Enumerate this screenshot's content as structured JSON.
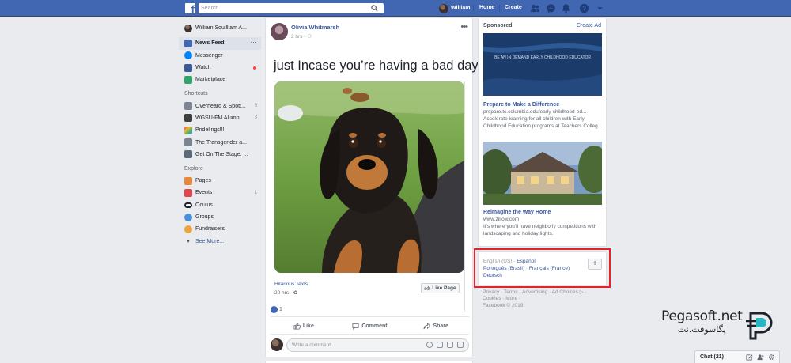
{
  "colors": {
    "brand": "#4267b2",
    "link": "#365899",
    "highlight": "#e4222a"
  },
  "topbar": {
    "search_placeholder": "Search",
    "user_name": "William",
    "home": "Home",
    "create": "Create",
    "icons": [
      "friends-icon",
      "messenger-icon",
      "notifications-icon",
      "help-icon",
      "chevron-down-icon"
    ]
  },
  "left_nav": {
    "profile": "William Squilliam A...",
    "main": [
      {
        "label": "News Feed",
        "icon": "news-feed-icon",
        "color": "#4267b2",
        "active": true
      },
      {
        "label": "Messenger",
        "icon": "messenger-icon",
        "color": "#0084ff"
      },
      {
        "label": "Watch",
        "icon": "watch-icon",
        "color": "#3b5998",
        "dot": true
      },
      {
        "label": "Marketplace",
        "icon": "marketplace-icon",
        "color": "#30a46c"
      }
    ],
    "shortcuts_title": "Shortcuts",
    "shortcuts": [
      {
        "label": "Overheard & Spott...",
        "count": "6",
        "icon": "megaphone-icon",
        "color": "#7a8591"
      },
      {
        "label": "WGSU-FM Alumni",
        "count": "3",
        "icon": "group-icon",
        "color": "#3d3d3d"
      },
      {
        "label": "Pridelings!!!",
        "count": "",
        "icon": "rainbow-icon",
        "color": "#e8883a"
      },
      {
        "label": "The Transgender a...",
        "count": "",
        "icon": "group-icon",
        "color": "#7a8591"
      },
      {
        "label": "Get On The Stage: ...",
        "count": "",
        "icon": "group-icon",
        "color": "#5b6978"
      }
    ],
    "explore_title": "Explore",
    "explore": [
      {
        "label": "Pages",
        "count": "",
        "icon": "pages-icon",
        "color": "#e8883a"
      },
      {
        "label": "Events",
        "count": "1",
        "icon": "events-icon",
        "color": "#e0474c"
      },
      {
        "label": "Oculus",
        "count": "",
        "icon": "oculus-icon",
        "color": "#1d2129"
      },
      {
        "label": "Groups",
        "count": "",
        "icon": "groups-icon",
        "color": "#4a90d9"
      },
      {
        "label": "Fundraisers",
        "count": "",
        "icon": "fundraisers-icon",
        "color": "#f0a33c"
      }
    ],
    "see_more": "See More..."
  },
  "post": {
    "author": "Olivia Whitmarsh",
    "time": "2 hrs",
    "text": "just Incase you’re having a bad day",
    "source_name": "Hilarious Texts",
    "source_time": "20 hrs",
    "like_page": "Like Page",
    "reaction_count": "1",
    "actions": {
      "like": "Like",
      "comment": "Comment",
      "share": "Share"
    },
    "comment_placeholder": "Write a comment..."
  },
  "sidebar": {
    "sponsored": "Sponsored",
    "create_ad": "Create Ad",
    "ad1": {
      "banner": "BE AN IN DEMAND EARLY CHILDHOOD EDUCATOR",
      "title": "Prepare to Make a Difference",
      "url": "prepare.tc.columbia.edu/early-childhood-ed...",
      "desc": "Accelerate learning for all children with Early Childhood Education programs at Teachers Colleg..."
    },
    "ad2": {
      "title": "Reimagine the Way Home",
      "url": "www.zillow.com",
      "desc": "It's where you'll have neighborly competitions with landscaping and holiday lights."
    }
  },
  "languages": {
    "current": "English (US)",
    "spanish": "Español",
    "portuguese": "Português (Brasil)",
    "french": "Français (France)",
    "german": "Deutsch",
    "add": "+"
  },
  "footer": {
    "line1": "Privacy · Terms · Advertising · Ad Choices ▷ ·",
    "line2": "Cookies · More ·",
    "line3": "Facebook © 2019"
  },
  "watermark": {
    "latin": "Pegasoft.net",
    "persian": "پگاسوفت.نت"
  },
  "chat": {
    "label": "Chat (21)"
  }
}
